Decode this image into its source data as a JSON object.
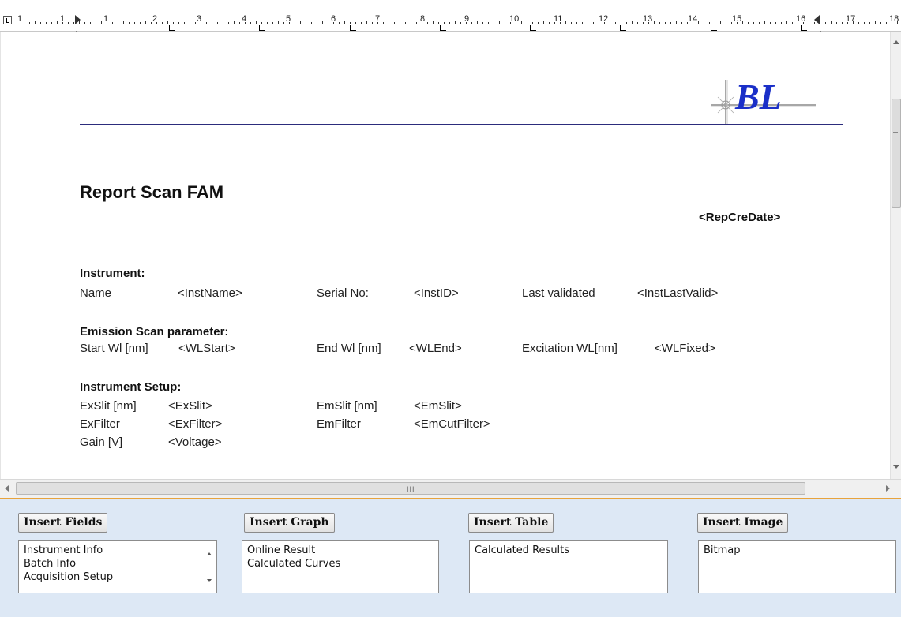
{
  "ruler": {
    "numbers": [
      "1",
      "1",
      "1",
      "2",
      "3",
      "4",
      "5",
      "6",
      "7",
      "8",
      "9",
      "10",
      "11",
      "12",
      "13",
      "14",
      "15",
      "16",
      "17",
      "18"
    ]
  },
  "document": {
    "logo_text": "BL",
    "title": "Report Scan FAM",
    "report_date_field": "<RepCreDate>",
    "sections": {
      "instrument": {
        "heading": "Instrument:",
        "row1": [
          "Name",
          "<InstName>",
          "Serial No:",
          "<InstID>",
          "Last validated",
          "<InstLastValid>"
        ]
      },
      "emission": {
        "heading": "Emission Scan parameter:",
        "row1": [
          "Start Wl [nm]",
          "<WLStart>",
          "End Wl [nm]",
          "<WLEnd>",
          "Excitation WL[nm]",
          "<WLFixed>"
        ]
      },
      "setup": {
        "heading": "Instrument Setup:",
        "row1": [
          "ExSlit [nm]",
          "<ExSlit>",
          "EmSlit [nm]",
          "<EmSlit>"
        ],
        "row2": [
          "ExFilter",
          "<ExFilter>",
          "EmFilter",
          "<EmCutFilter>"
        ],
        "row3": [
          "Gain [V]",
          "<Voltage>"
        ]
      }
    }
  },
  "scrollbar": {
    "grip": "III"
  },
  "panel": {
    "insert_fields": {
      "label": "Insert Fields",
      "items": [
        "Instrument Info",
        "Batch Info",
        "Acquisition Setup"
      ]
    },
    "insert_graph": {
      "label": "Insert Graph",
      "items": [
        "Online Result",
        "Calculated Curves"
      ]
    },
    "insert_table": {
      "label": "Insert Table",
      "items": [
        "Calculated Results"
      ]
    },
    "insert_image": {
      "label": "Insert Image",
      "items": [
        "Bitmap"
      ]
    }
  },
  "colors": {
    "accent_orange": "#e8a33c",
    "panel_bg": "#dde8f5",
    "logo_blue": "#1a2fc8",
    "header_rule": "#2c2c7c"
  }
}
